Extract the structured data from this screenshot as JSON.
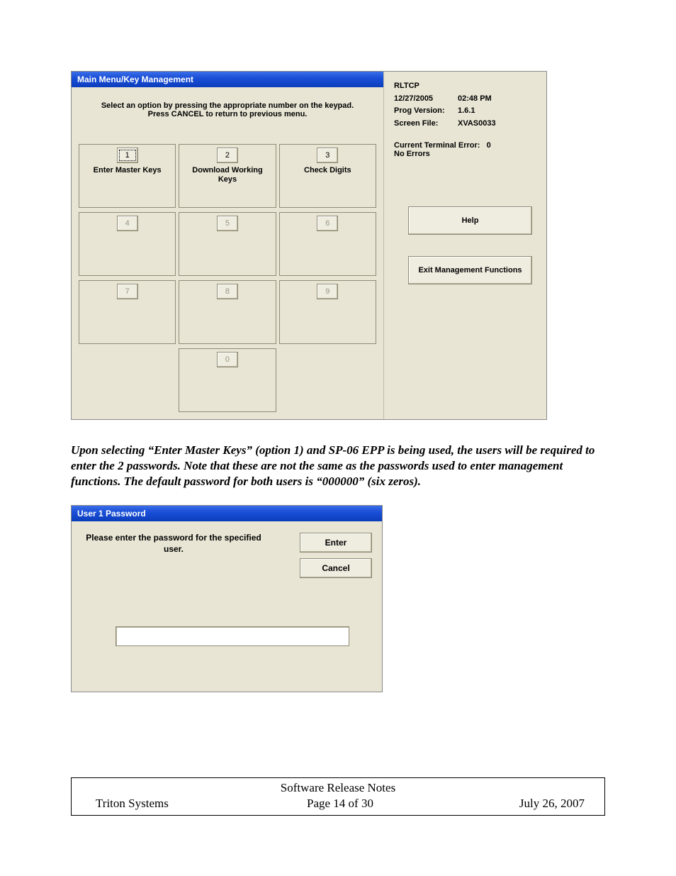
{
  "screenshot1": {
    "title": "Main Menu/Key Management",
    "instruction_line1": "Select an option by pressing the appropriate number on the keypad.",
    "instruction_line2": "Press CANCEL to return to previous menu.",
    "keys": [
      {
        "num": "1",
        "label": "Enter Master Keys",
        "enabled": true,
        "focused": true
      },
      {
        "num": "2",
        "label": "Download Working Keys",
        "enabled": true,
        "focused": false
      },
      {
        "num": "3",
        "label": "Check Digits",
        "enabled": true,
        "focused": false
      },
      {
        "num": "4",
        "label": "",
        "enabled": false,
        "focused": false
      },
      {
        "num": "5",
        "label": "",
        "enabled": false,
        "focused": false
      },
      {
        "num": "6",
        "label": "",
        "enabled": false,
        "focused": false
      },
      {
        "num": "7",
        "label": "",
        "enabled": false,
        "focused": false
      },
      {
        "num": "8",
        "label": "",
        "enabled": false,
        "focused": false
      },
      {
        "num": "9",
        "label": "",
        "enabled": false,
        "focused": false
      },
      {
        "num": "0",
        "label": "",
        "enabled": false,
        "focused": false
      }
    ],
    "side": {
      "program": "RLTCP",
      "date": "12/27/2005",
      "time": "02:48 PM",
      "prog_version_label": "Prog Version:",
      "prog_version": "1.6.1",
      "screen_file_label": "Screen File:",
      "screen_file": "XVAS0033",
      "error_label": "Current Terminal Error:",
      "error_value": "0",
      "error_status": "No Errors",
      "help_btn": "Help",
      "exit_btn": "Exit Management Functions"
    }
  },
  "paragraph": "Upon selecting “Enter Master Keys” (option 1) and SP-06 EPP is being used, the users will be required to enter the 2 passwords.  Note that these are not the same as the passwords used to enter management functions.  The default password for both users is “000000” (six zeros).",
  "screenshot2": {
    "title": "User 1 Password",
    "message": "Please enter the password for the specified user.",
    "enter_btn": "Enter",
    "cancel_btn": "Cancel",
    "input_value": ""
  },
  "footer": {
    "doc_title": "Software Release Notes",
    "company": "Triton Systems",
    "page": "Page 14 of 30",
    "date": "July 26, 2007"
  }
}
